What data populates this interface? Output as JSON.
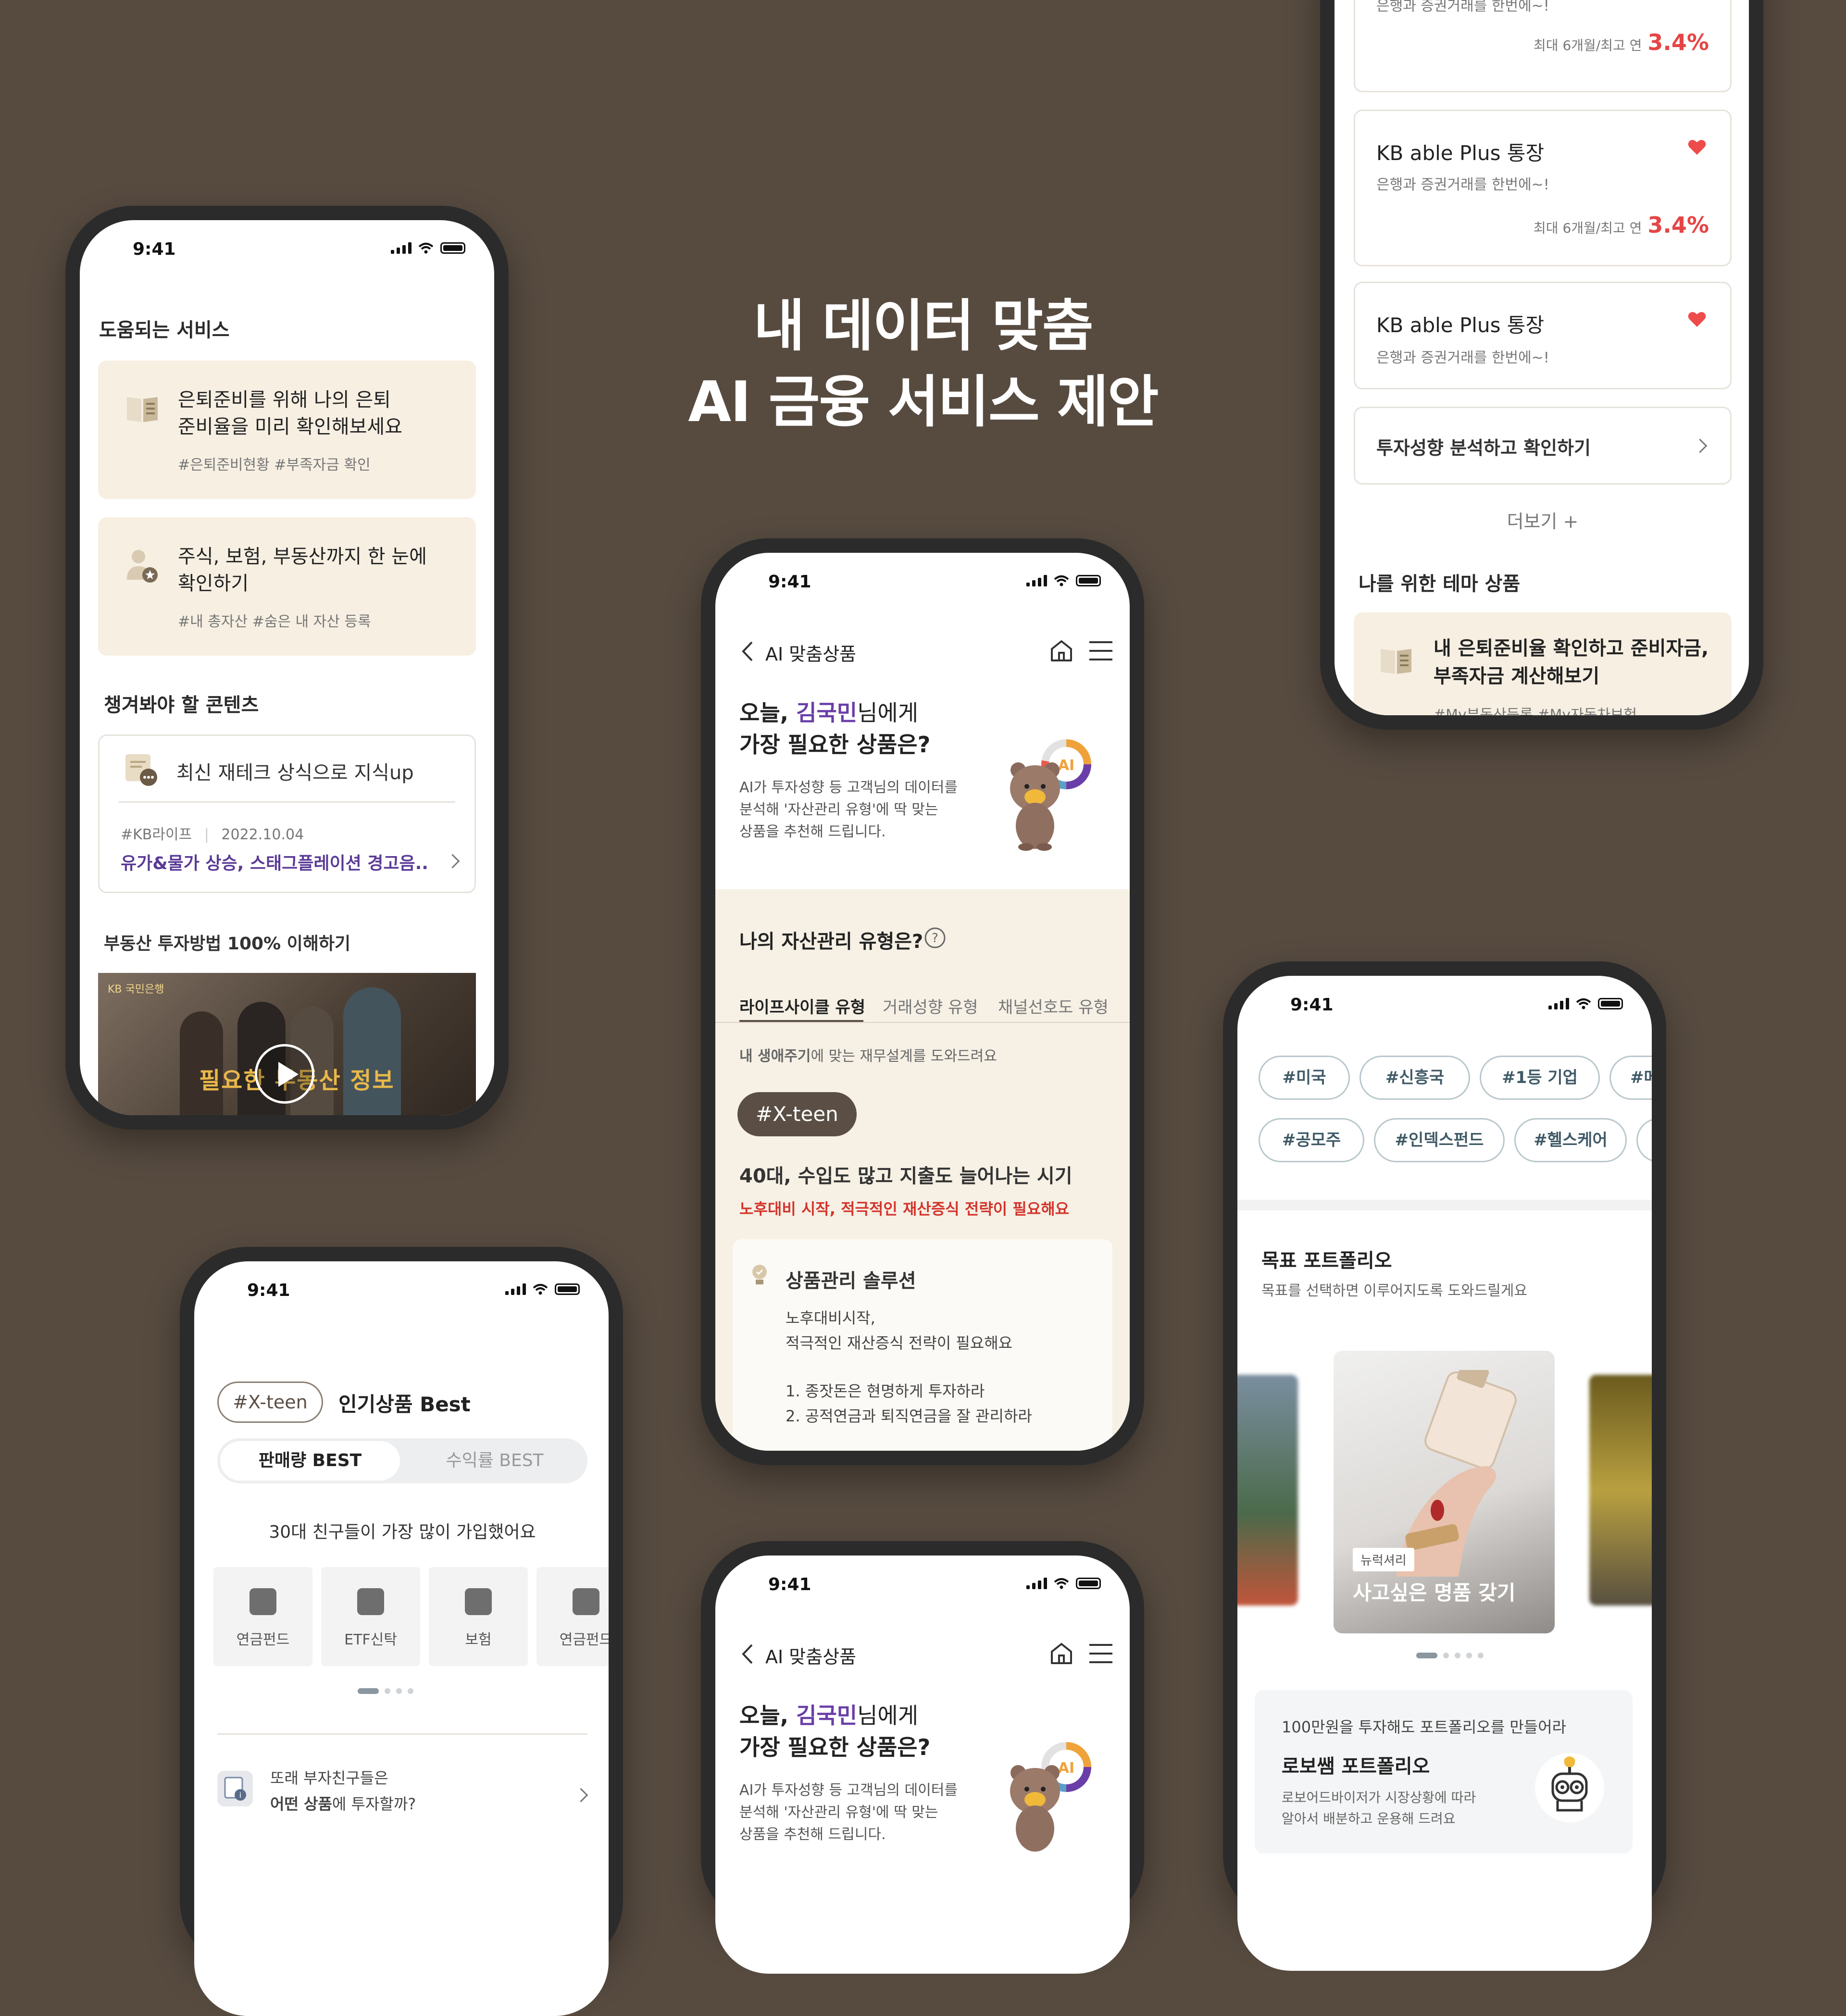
{
  "hero": {
    "line1": "내 데이터 맞춤",
    "line2": "AI 금융 서비스 제안"
  },
  "status_time": "9:41",
  "phone1": {
    "section1_title": "도움되는 서비스",
    "card1": {
      "title_line1": "은퇴준비를 위해 나의 은퇴",
      "title_line2": "준비율을 미리 확인해보세요",
      "tags": "#은퇴준비현황 #부족자금 확인"
    },
    "card2": {
      "title_line1": "주식, 보험, 부동산까지 한 눈에",
      "title_line2": "확인하기",
      "tags": "#내 총자산 #숨은 내 자산 등록"
    },
    "section2_title": "챙겨봐야 할 콘텐츠",
    "content_card": {
      "header": "최신 재테크 상식으로 지식up",
      "source": "#KB라이프",
      "date": "2022.10.04",
      "headline": "유가&물가 상승, 스태그플레이션 경고음.."
    },
    "section3_title": "부동산 투자방법 100% 이해하기",
    "video": {
      "brand": "KB 국민은행",
      "caption": "필요한 부동산 정보"
    }
  },
  "phone2": {
    "tagline_prefix": "…",
    "list": [
      {
        "subtitle": "은행과 증권거래를 한번에~!",
        "rate_label": "최대 6개월/최고 연",
        "rate": "3.4%"
      },
      {
        "title": "KB able Plus 통장",
        "subtitle": "은행과 증권거래를 한번에~!",
        "rate_label": "최대 6개월/최고 연",
        "rate": "3.4%"
      },
      {
        "title": "KB able Plus 통장",
        "subtitle": "은행과 증권거래를 한번에~!"
      }
    ],
    "analyze": "투자성향 분석하고 확인하기",
    "more": "더보기 +",
    "theme_title": "나를 위한 테마 상품",
    "theme_card_line1": "내 은퇴준비율 확인하고 준비자금,",
    "theme_card_line2": "부족자금 계산해보기",
    "theme_card_tags": "#My부동산등록 #My자동차보험"
  },
  "phone3": {
    "nav_title": "AI 맞춤상품",
    "greeting_pre": "오늘, ",
    "user_name": "김국민",
    "greeting_post": "님에게",
    "question": "가장 필요한 상품은?",
    "desc_line1": "AI가 투자성향 등 고객님의 데이터를",
    "desc_line2": "분석해 '자산관리 유형'에 딱 맞는",
    "desc_line3": "상품을 추천해 드립니다.",
    "ai_badge": "AI",
    "type_title": "나의 자산관리 유형은?",
    "tabs": [
      "라이프사이클 유형",
      "거래성향 유형",
      "채널선호도 유형"
    ],
    "tab_desc_bold": "내 생애주기",
    "tab_desc_rest": "에 맞는 재무설계를 도와드려요",
    "type_tag": "#X-teen",
    "type_headline": "40대, 수입도 많고 지출도 늘어나는 시기",
    "type_warning": "노후대비 시작, 적극적인 재산증식 전략이 필요해요",
    "solution_title": "상품관리 솔루션",
    "solution_line1": "노후대비시작,",
    "solution_line2": "적극적인 재산증식 전략이 필요해요",
    "solution_item1": "1. 종잣돈은 현명하게 투자하라",
    "solution_item2": "2. 공적연금과 퇴직연금을 잘 관리하라"
  },
  "phone4": {
    "type_tag": "#X-teen",
    "title": "인기상품 Best",
    "seg_active": "판매량 BEST",
    "seg_inactive": "수익률 BEST",
    "subtitle": "30대 친구들이 가장 많이 가입했어요",
    "categories": [
      "연금펀드",
      "ETF신탁",
      "보험",
      "연금펀드"
    ],
    "bottom_line1": "또래 부자친구들은",
    "bottom_bold": "어떤 상품",
    "bottom_rest": "에 투자할까?"
  },
  "phone5": {
    "chips_row1": [
      "#미국",
      "#신흥국",
      "#1등 기업",
      "#메가"
    ],
    "chips_row2": [
      "#공모주",
      "#인덱스펀드",
      "#헬스케어"
    ],
    "portfolio_title": "목표 포트폴리오",
    "portfolio_sub": "목표를 선택하면 이루어지도록 도와드릴게요",
    "card_tag": "뉴럭셔리",
    "card_title": "사고싶은 명품 갖기",
    "robo_top": "100만원을 투자해도 포트폴리오를 만들어라",
    "robo_title": "로보쌤 포트폴리오",
    "robo_line1": "로보어드바이저가 시장상황에 따라",
    "robo_line2": "알아서 배분하고 운용해 드려요"
  },
  "colors": {
    "background": "#574b40",
    "beige_card": "#f6efe2",
    "accent_purple": "#6a3ea8",
    "warning_red": "#d4332b",
    "rate_red": "#e54545"
  }
}
